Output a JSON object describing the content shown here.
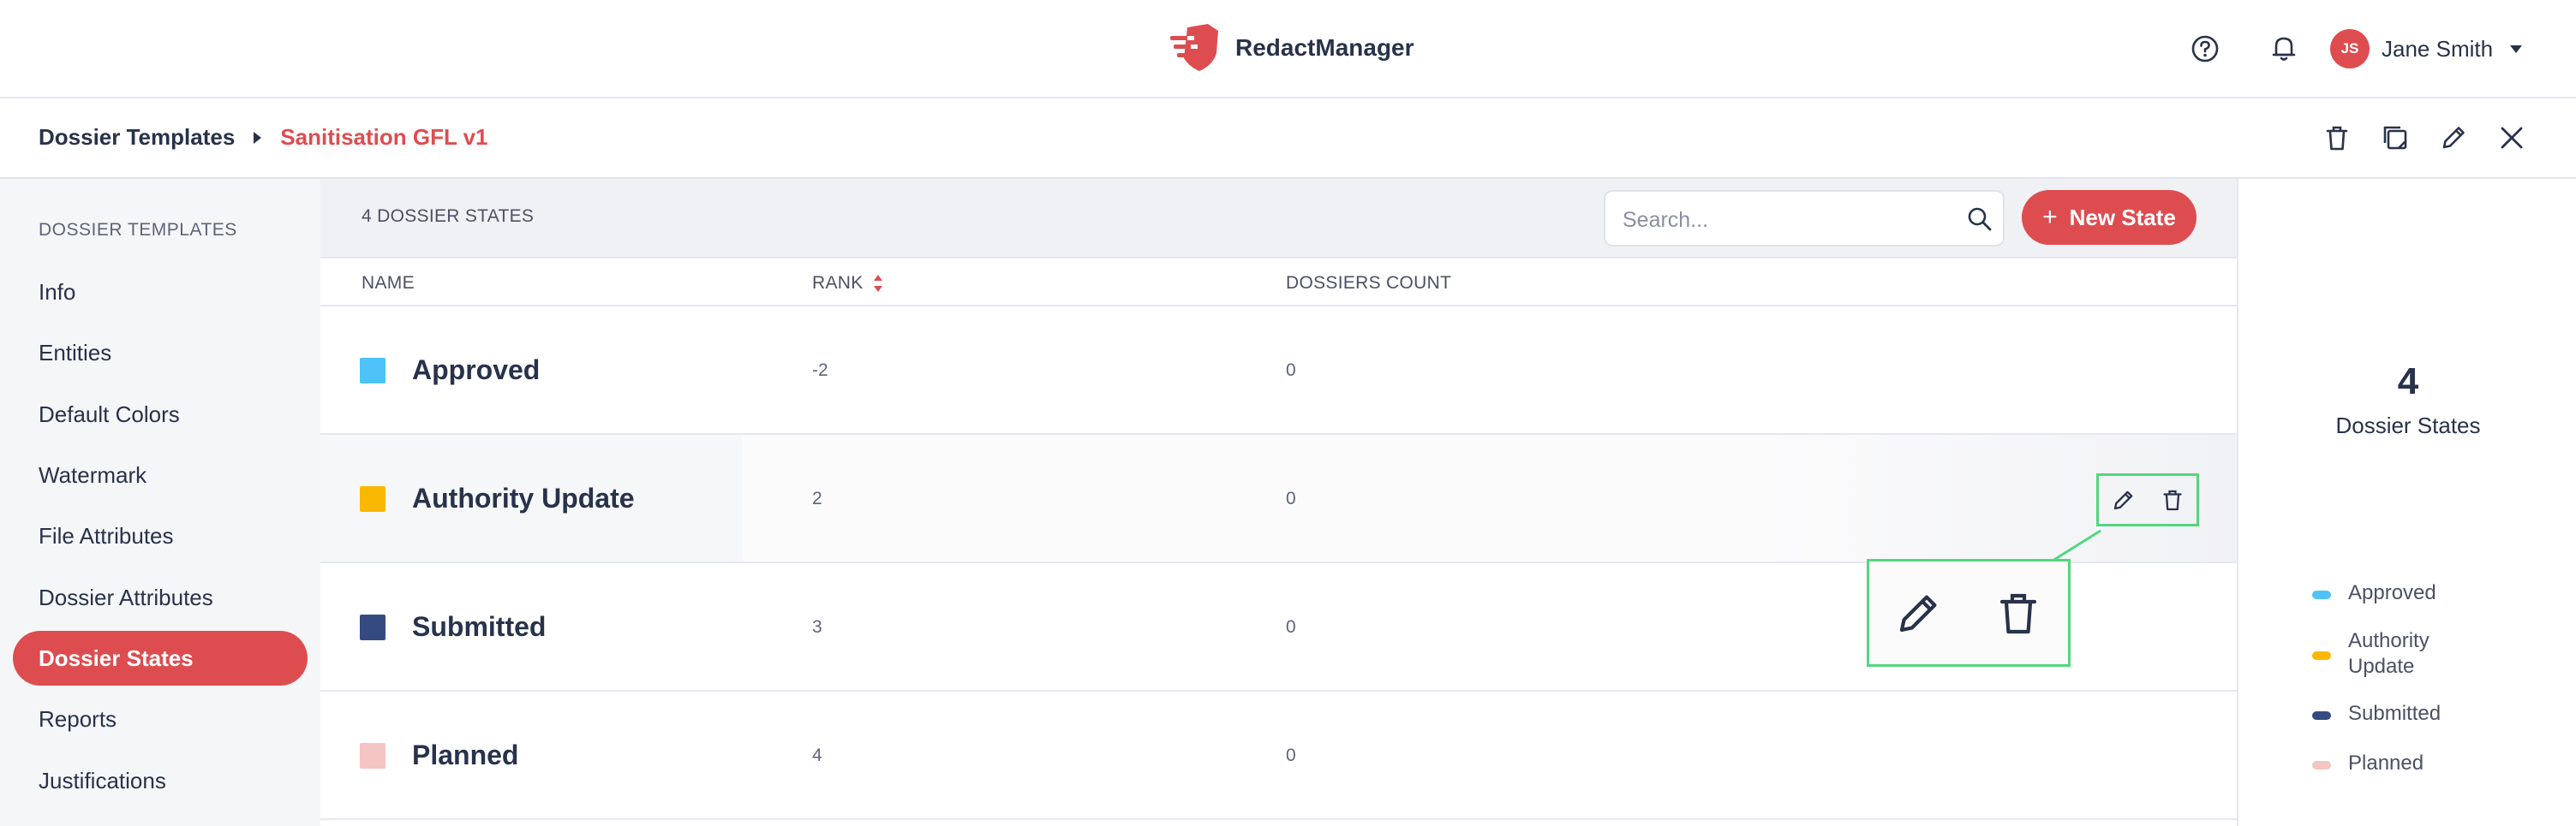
{
  "app": {
    "name": "RedactManager"
  },
  "user": {
    "initials": "JS",
    "name": "Jane Smith"
  },
  "breadcrumb": {
    "root": "Dossier Templates",
    "current": "Sanitisation GFL v1"
  },
  "sidebar": {
    "heading": "DOSSIER TEMPLATES",
    "items": [
      {
        "label": "Info",
        "active": false
      },
      {
        "label": "Entities",
        "active": false
      },
      {
        "label": "Default Colors",
        "active": false
      },
      {
        "label": "Watermark",
        "active": false
      },
      {
        "label": "File Attributes",
        "active": false
      },
      {
        "label": "Dossier Attributes",
        "active": false
      },
      {
        "label": "Dossier States",
        "active": true
      },
      {
        "label": "Reports",
        "active": false
      },
      {
        "label": "Justifications",
        "active": false
      }
    ]
  },
  "table": {
    "count_label": "4 DOSSIER STATES",
    "search_placeholder": "Search...",
    "new_button": "New State",
    "columns": {
      "name": "NAME",
      "rank": "RANK",
      "count": "DOSSIERS COUNT"
    },
    "rows": [
      {
        "name": "Approved",
        "rank": "-2",
        "count": "0",
        "color": "#4dc3f7"
      },
      {
        "name": "Authority Update",
        "rank": "2",
        "count": "0",
        "color": "#fbb800"
      },
      {
        "name": "Submitted",
        "rank": "3",
        "count": "0",
        "color": "#354a80"
      },
      {
        "name": "Planned",
        "rank": "4",
        "count": "0",
        "color": "#f4c5c3"
      }
    ]
  },
  "stats": {
    "total": "4",
    "label": "Dossier States",
    "legend": [
      {
        "label": "Approved",
        "color": "#4dc3f7"
      },
      {
        "label": "Authority Update",
        "color": "#fbb800"
      },
      {
        "label": "Submitted",
        "color": "#354a80"
      },
      {
        "label": "Planned",
        "color": "#f4c5c3"
      }
    ]
  },
  "colors": {
    "accent": "#dd4d50",
    "highlight": "#53d77e",
    "text": "#28324a"
  }
}
